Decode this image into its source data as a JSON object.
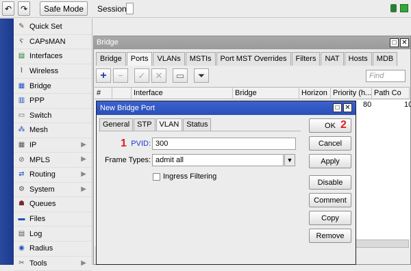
{
  "toolbar": {
    "undo_icon": "undo-icon",
    "redo_icon": "redo-icon",
    "safe_mode": "Safe Mode",
    "session_label": "Session:"
  },
  "sidebar": {
    "items": [
      {
        "label": "Quick Set",
        "icon": "quick-set-icon",
        "arrow": false
      },
      {
        "label": "CAPsMAN",
        "icon": "capsman-icon",
        "arrow": false
      },
      {
        "label": "Interfaces",
        "icon": "interfaces-icon",
        "arrow": false
      },
      {
        "label": "Wireless",
        "icon": "wireless-icon",
        "arrow": false
      },
      {
        "label": "Bridge",
        "icon": "bridge-icon",
        "arrow": false
      },
      {
        "label": "PPP",
        "icon": "ppp-icon",
        "arrow": false
      },
      {
        "label": "Switch",
        "icon": "switch-icon",
        "arrow": false
      },
      {
        "label": "Mesh",
        "icon": "mesh-icon",
        "arrow": false
      },
      {
        "label": "IP",
        "icon": "ip-icon",
        "arrow": true
      },
      {
        "label": "MPLS",
        "icon": "mpls-icon",
        "arrow": true
      },
      {
        "label": "Routing",
        "icon": "routing-icon",
        "arrow": true
      },
      {
        "label": "System",
        "icon": "system-icon",
        "arrow": true
      },
      {
        "label": "Queues",
        "icon": "queues-icon",
        "arrow": false
      },
      {
        "label": "Files",
        "icon": "files-icon",
        "arrow": false
      },
      {
        "label": "Log",
        "icon": "log-icon",
        "arrow": false
      },
      {
        "label": "Radius",
        "icon": "radius-icon",
        "arrow": false
      },
      {
        "label": "Tools",
        "icon": "tools-icon",
        "arrow": true
      }
    ]
  },
  "bridge_window": {
    "title": "Bridge",
    "tabs": [
      "Bridge",
      "Ports",
      "VLANs",
      "MSTIs",
      "Port MST Overrides",
      "Filters",
      "NAT",
      "Hosts",
      "MDB"
    ],
    "active_tab": "Ports",
    "find_placeholder": "Find",
    "columns": [
      "#",
      "Interface",
      "Bridge",
      "Horizon",
      "Priority (h...",
      "Path Co"
    ],
    "row_values": {
      "priority": "80",
      "path_cost": "10"
    }
  },
  "dialog": {
    "title": "New Bridge Port",
    "tabs": [
      "General",
      "STP",
      "VLAN",
      "Status"
    ],
    "active_tab": "VLAN",
    "pvid_label": "PVID:",
    "pvid_value": "300",
    "frame_types_label": "Frame Types:",
    "frame_types_value": "admit all",
    "ingress_label": "Ingress Filtering",
    "buttons": {
      "ok": "OK",
      "cancel": "Cancel",
      "apply": "Apply",
      "disable": "Disable",
      "comment": "Comment",
      "copy": "Copy",
      "remove": "Remove"
    },
    "callout_1": "1",
    "callout_2": "2"
  },
  "colors": {
    "dialog_title_bg": "#2f56c0",
    "callout": "#e31b1b"
  }
}
